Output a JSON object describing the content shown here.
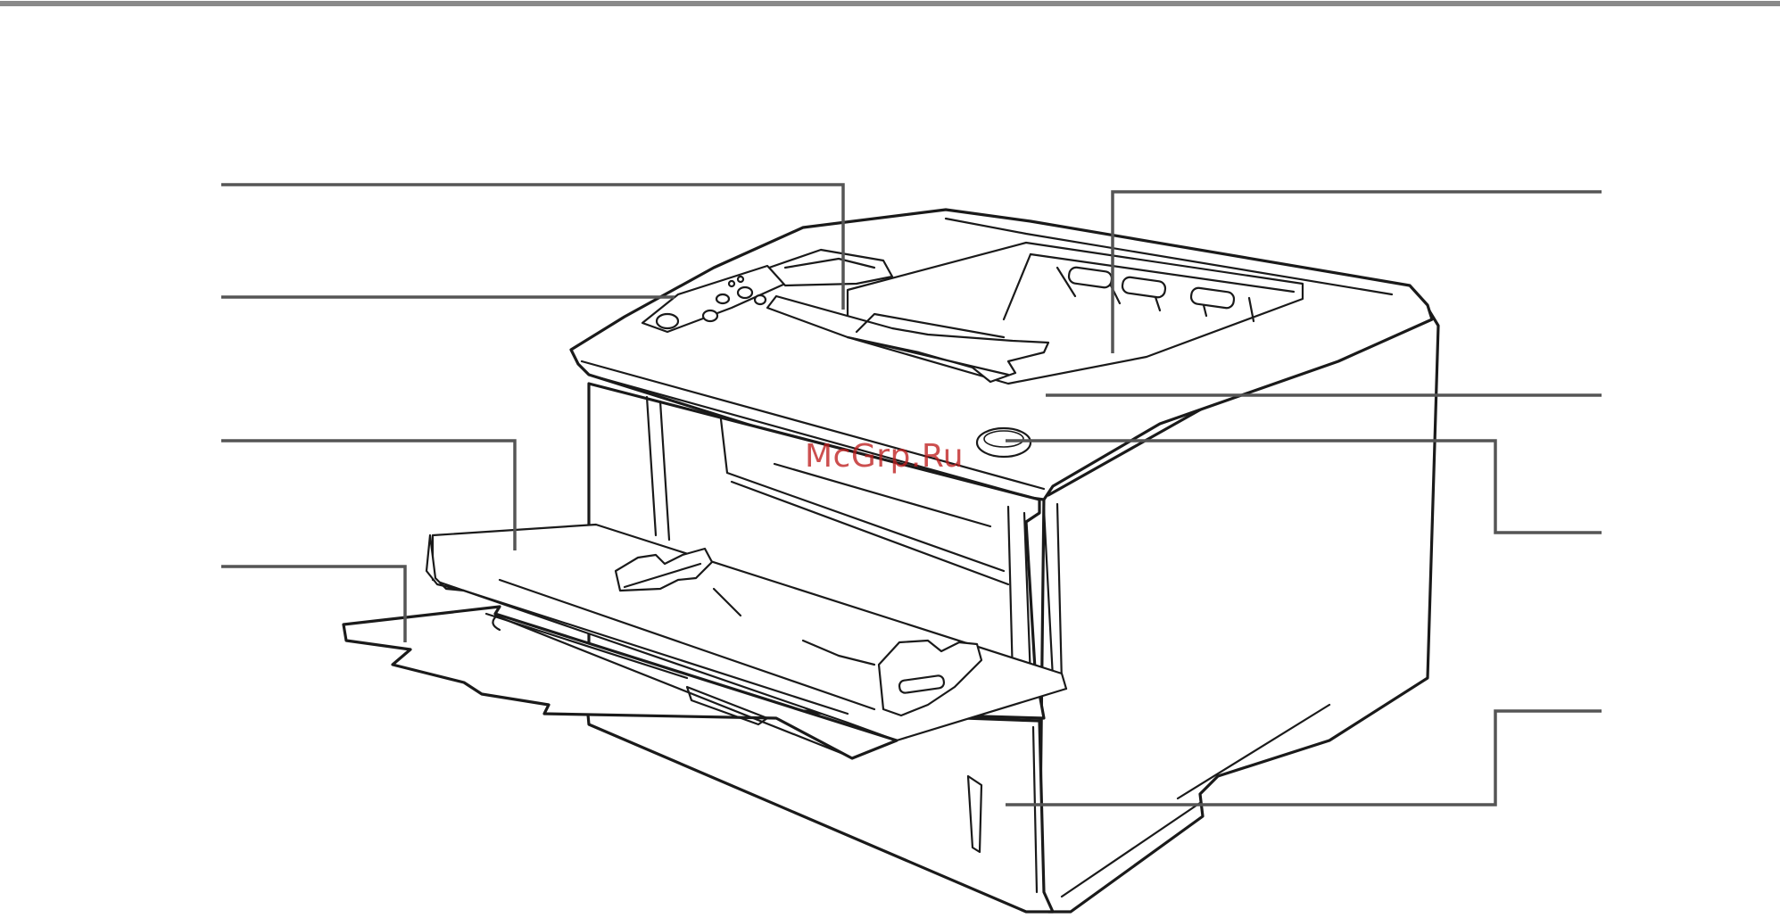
{
  "watermark": {
    "text": "McGrp.Ru",
    "color": "#be1e1e"
  },
  "figure": {
    "rule_color": "#8a8a8a",
    "leader_color": "#555555",
    "line_art_color": "#1a1a1a",
    "callout_count": 9
  }
}
